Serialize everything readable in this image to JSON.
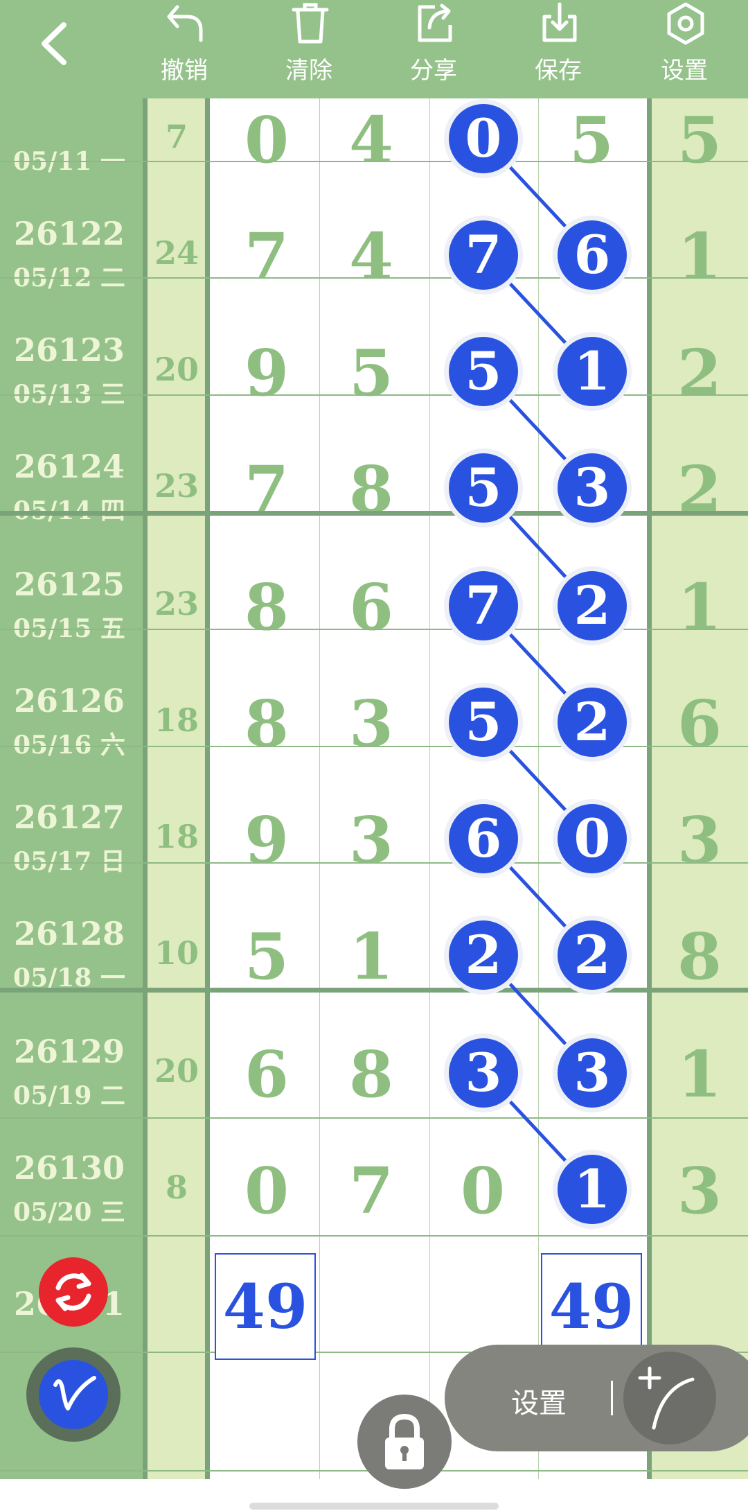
{
  "toolbar": {
    "back_icon": "chevron-left-icon",
    "undo": {
      "label": "撤销",
      "icon": "undo-icon"
    },
    "clear": {
      "label": "清除",
      "icon": "trash-icon"
    },
    "share": {
      "label": "分享",
      "icon": "share-icon"
    },
    "save": {
      "label": "保存",
      "icon": "download-icon"
    },
    "settings": {
      "label": "设置",
      "icon": "hexagon-gear-icon"
    }
  },
  "colors": {
    "toolbar_bg": "#94c28a",
    "ball": "#2a52e0",
    "digit_green": "#8fbf80",
    "refresh_red": "#e8242d"
  },
  "rows": [
    {
      "period": "",
      "date": "05/11 一",
      "sum": "7",
      "d1": "0",
      "d2": "4",
      "d3": "0",
      "d4": "5",
      "right": "5",
      "ball_col": 3
    },
    {
      "period": "26122",
      "date": "05/12 二",
      "sum": "24",
      "d1": "7",
      "d2": "4",
      "d3": "7",
      "d4": "6",
      "right": "1",
      "ball_col": 4
    },
    {
      "period": "26123",
      "date": "05/13 三",
      "sum": "20",
      "d1": "9",
      "d2": "5",
      "d3": "5",
      "d4": "1",
      "right": "2",
      "ball_col": 3
    },
    {
      "period": "26124",
      "date": "05/14 四",
      "sum": "23",
      "d1": "7",
      "d2": "8",
      "d3": "5",
      "d4": "3",
      "right": "2",
      "ball_col": 4
    },
    {
      "period": "26125",
      "date": "05/15 五",
      "sum": "23",
      "d1": "8",
      "d2": "6",
      "d3": "7",
      "d4": "2",
      "right": "1",
      "ball_col": 3
    },
    {
      "period": "26126",
      "date": "05/16 六",
      "sum": "18",
      "d1": "8",
      "d2": "3",
      "d3": "5",
      "d4": "2",
      "right": "6",
      "ball_col": 4
    },
    {
      "period": "26127",
      "date": "05/17 日",
      "sum": "18",
      "d1": "9",
      "d2": "3",
      "d3": "6",
      "d4": "0",
      "right": "3",
      "ball_col": 3
    },
    {
      "period": "26128",
      "date": "05/18 一",
      "sum": "10",
      "d1": "5",
      "d2": "1",
      "d3": "2",
      "d4": "2",
      "right": "8",
      "ball_col": 4
    },
    {
      "period": "26129",
      "date": "05/19 二",
      "sum": "20",
      "d1": "6",
      "d2": "8",
      "d3": "3",
      "d4": "3",
      "right": "1",
      "ball_col": 3
    },
    {
      "period": "26130",
      "date": "05/20 三",
      "sum": "8",
      "d1": "0",
      "d2": "7",
      "d3": "0",
      "d4": "1",
      "right": "3",
      "ball_col": 4
    }
  ],
  "partial_period": "26131",
  "predictions": {
    "col1": "49",
    "col4": "49"
  },
  "floating": {
    "settings_label": "设置",
    "refresh_icon": "refresh-icon",
    "pen_icon": "pen-icon",
    "lock_icon": "lock-icon",
    "curve_icon": "add-curve-icon"
  }
}
